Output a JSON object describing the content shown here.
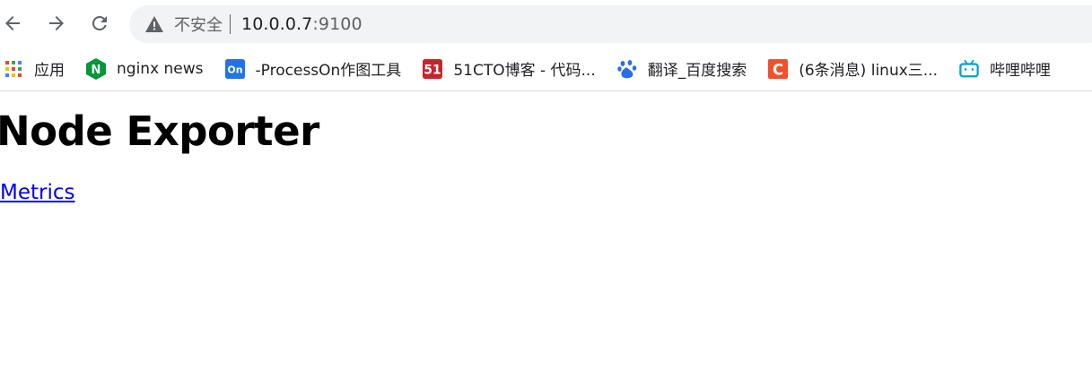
{
  "omnibox": {
    "security_label": "不安全",
    "url_host": "10.0.0.7",
    "url_port": ":9100"
  },
  "bookmarks": [
    {
      "label": "应用",
      "icon": "apps-grid-icon"
    },
    {
      "label": "nginx news",
      "icon": "nginx-icon"
    },
    {
      "label": "-ProcessOn作图工具",
      "icon": "processon-icon"
    },
    {
      "label": "51CTO博客 - 代码...",
      "icon": "51cto-icon"
    },
    {
      "label": "翻译_百度搜索",
      "icon": "baidu-paw-icon"
    },
    {
      "label": "(6条消息) linux三...",
      "icon": "csdn-c-icon"
    },
    {
      "label": "哔哩哔哩",
      "icon": "bilibili-tv-icon"
    }
  ],
  "icon_text": {
    "nginx": "N",
    "processon": "On",
    "cto": "51",
    "csdn": "C"
  },
  "page": {
    "title": "Node Exporter",
    "metrics_link": "Metrics"
  },
  "colors": {
    "link": "#0000ee",
    "omnibox_bg": "#f1f3f4",
    "nginx_green": "#009639",
    "processon_blue": "#1f74e8",
    "cto_red": "#c8242d",
    "baidu_blue": "#2b6de6",
    "csdn_red": "#f0502c",
    "bilibili_blue": "#00a1d6"
  }
}
